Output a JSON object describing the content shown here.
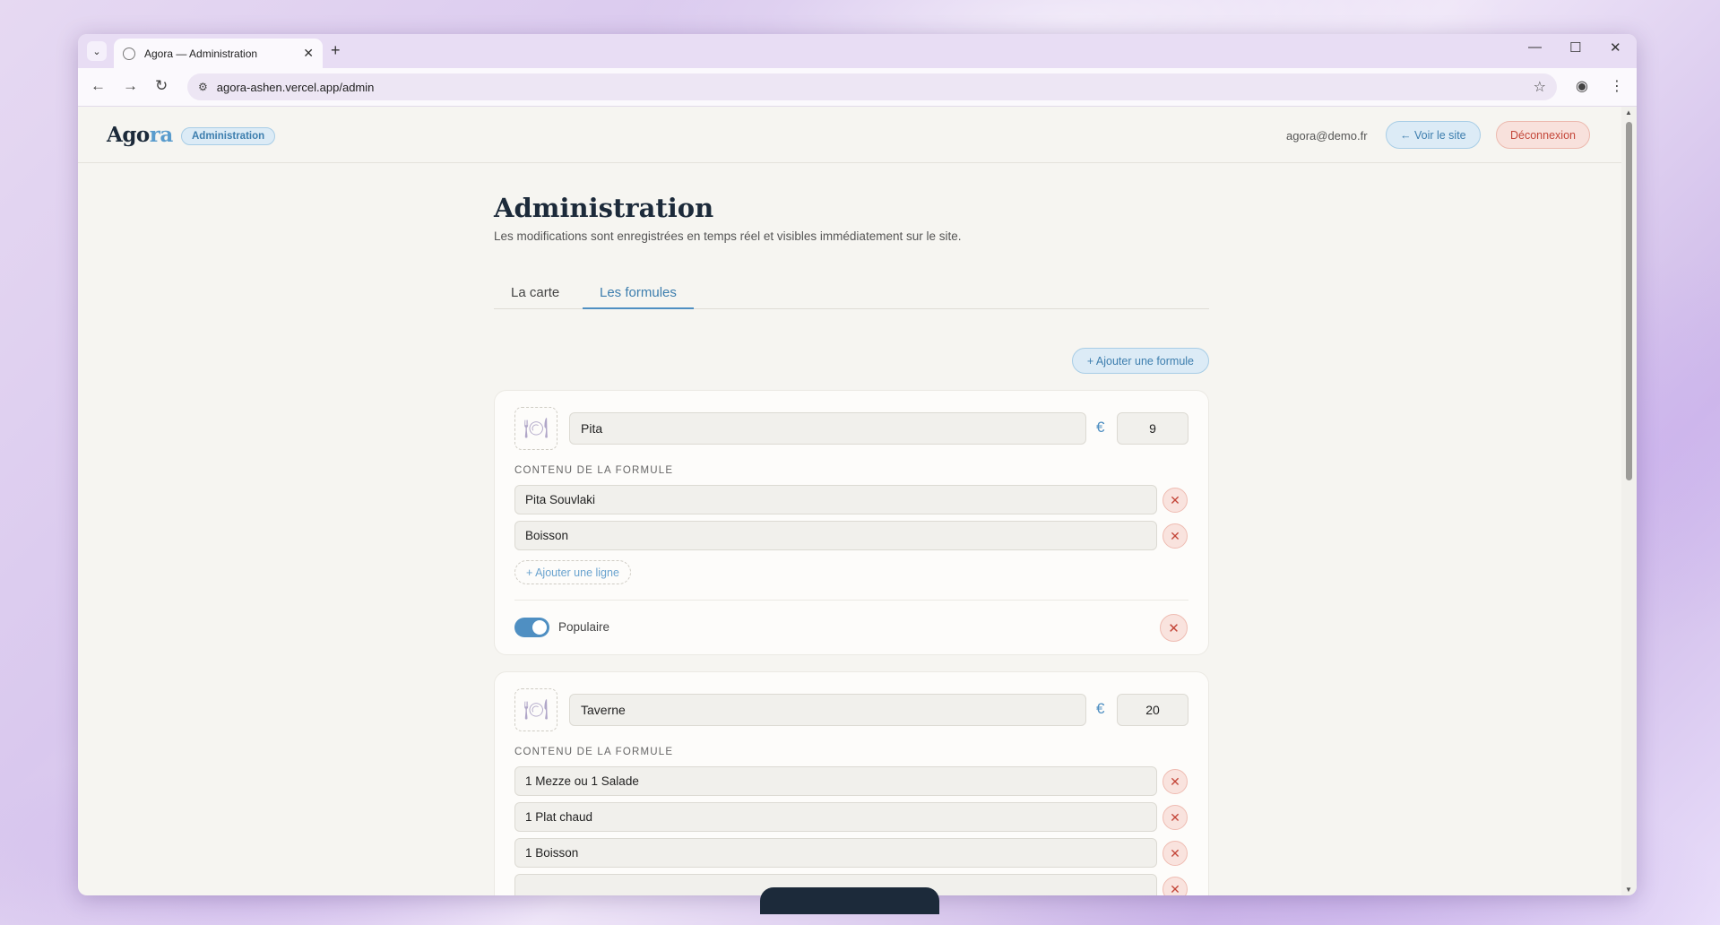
{
  "browser": {
    "tab_title": "Agora — Administration",
    "url": "agora-ashen.vercel.app/admin"
  },
  "header": {
    "logo_main": "Ago",
    "logo_accent": "ra",
    "badge": "Administration",
    "email": "agora@demo.fr",
    "view_site": "← Voir le site",
    "logout": "Déconnexion"
  },
  "main": {
    "title": "Administration",
    "subtitle": "Les modifications sont enregistrées en temps réel et visibles immédiatement sur le site.",
    "tabs": [
      {
        "label": "La carte"
      },
      {
        "label": "Les formules"
      }
    ],
    "add_formula": "+ Ajouter une formule"
  },
  "formulas": [
    {
      "name": "Pita",
      "currency": "€",
      "price": "9",
      "content_label": "CONTENU DE LA FORMULE",
      "lines": [
        "Pita Souvlaki",
        "Boisson"
      ],
      "add_line": "+ Ajouter une ligne",
      "popular_label": "Populaire",
      "popular": true
    },
    {
      "name": "Taverne",
      "currency": "€",
      "price": "20",
      "content_label": "CONTENU DE LA FORMULE",
      "lines": [
        "1 Mezze ou 1 Salade",
        "1 Plat chaud",
        "1 Boisson"
      ]
    }
  ],
  "icons": {
    "placeholder": "plate-icon",
    "remove": "close-icon"
  }
}
